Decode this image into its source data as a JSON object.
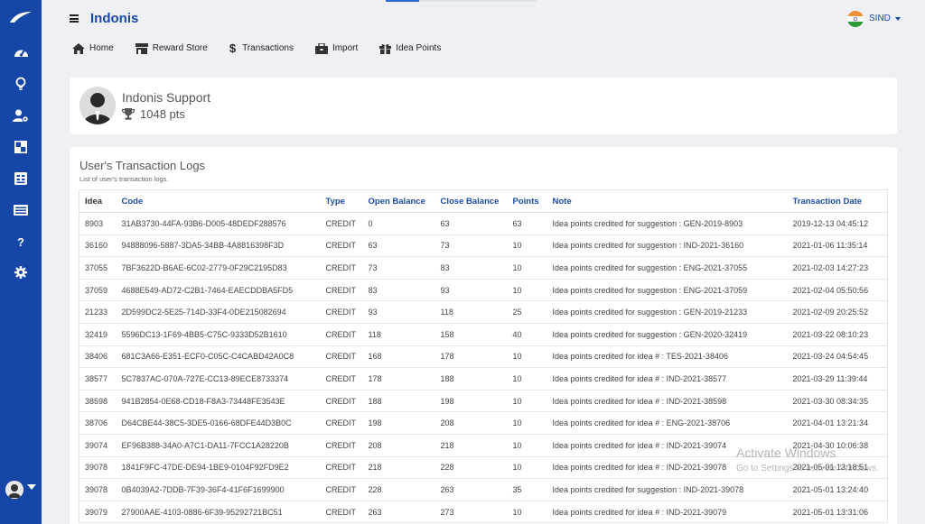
{
  "app": {
    "title": "Indonis"
  },
  "header": {
    "language": "SIND"
  },
  "nav": [
    {
      "label": "Home",
      "icon": "home-icon"
    },
    {
      "label": "Reward Store",
      "icon": "store-icon"
    },
    {
      "label": "Transactions",
      "icon": "dollar-icon"
    },
    {
      "label": "Import",
      "icon": "import-icon"
    },
    {
      "label": "Idea Points",
      "icon": "gift-icon"
    }
  ],
  "sidebar": {
    "icons": [
      "dashboard-icon",
      "lightbulb-icon",
      "user-settings-icon",
      "layout-icon",
      "calculator-icon",
      "list-icon",
      "help-icon",
      "settings-icon"
    ]
  },
  "profile": {
    "name": "Indonis Support",
    "points": "1048 pts"
  },
  "logs": {
    "title": "User's Transaction Logs",
    "subtitle": "List of user's transaction logs.",
    "columns": [
      "Idea",
      "Code",
      "Type",
      "Open Balance",
      "Close Balance",
      "Points",
      "Note",
      "Transaction Date"
    ],
    "rows": [
      [
        "8903",
        "31AB3730-44FA-93B6-D005-48DEDF288576",
        "CREDIT",
        "0",
        "63",
        "63",
        "Idea points credited for suggestion : GEN-2019-8903",
        "2019-12-13 04:45:12"
      ],
      [
        "36160",
        "94888096-5887-3DA5-34BB-4A8816398F3D",
        "CREDIT",
        "63",
        "73",
        "10",
        "Idea points credited for suggestion : IND-2021-36160",
        "2021-01-06 11:35:14"
      ],
      [
        "37055",
        "7BF3622D-B6AE-6C02-2779-0F29C2195D83",
        "CREDIT",
        "73",
        "83",
        "10",
        "Idea points credited for suggestion : ENG-2021-37055",
        "2021-02-03 14:27:23"
      ],
      [
        "37059",
        "4688E549-AD72-C2B1-7464-EAECDDBA5FD5",
        "CREDIT",
        "83",
        "93",
        "10",
        "Idea points credited for suggestion : ENG-2021-37059",
        "2021-02-04 05:50:56"
      ],
      [
        "21233",
        "2D599DC2-5E25-714D-33F4-0DE215082694",
        "CREDIT",
        "93",
        "118",
        "25",
        "Idea points credited for suggestion : GEN-2019-21233",
        "2021-02-09 20:25:52"
      ],
      [
        "32419",
        "5596DC13-1F69-4BB5-C75C-9333D52B1610",
        "CREDIT",
        "118",
        "158",
        "40",
        "Idea points credited for suggestion : GEN-2020-32419",
        "2021-03-22 08:10:23"
      ],
      [
        "38406",
        "681C3A66-E351-ECF0-C05C-C4CABD42A0C8",
        "CREDIT",
        "168",
        "178",
        "10",
        "Idea points credited for idea # : TES-2021-38406",
        "2021-03-24 04:54:45"
      ],
      [
        "38577",
        "5C7837AC-070A-727E-CC13-89ECE8733374",
        "CREDIT",
        "178",
        "188",
        "10",
        "Idea points credited for idea # : IND-2021-38577",
        "2021-03-29 11:39:44"
      ],
      [
        "38598",
        "941B2854-0E68-CD18-F8A3-73448FE3543E",
        "CREDIT",
        "188",
        "198",
        "10",
        "Idea points credited for idea # : IND-2021-38598",
        "2021-03-30 08:34:35"
      ],
      [
        "38706",
        "D64CBE44-38C5-3DE5-0166-68DFE44D3B0C",
        "CREDIT",
        "198",
        "208",
        "10",
        "Idea points credited for idea # : ENG-2021-38706",
        "2021-04-01 13:21:34"
      ],
      [
        "39074",
        "EF96B388-34A0-A7C1-DA11-7FCC1A28220B",
        "CREDIT",
        "208",
        "218",
        "10",
        "Idea points credited for idea # : IND-2021-39074",
        "2021-04-30 10:06:38"
      ],
      [
        "39078",
        "1841F9FC-47DE-DE94-1BE9-0104F92FD9E2",
        "CREDIT",
        "218",
        "228",
        "10",
        "Idea points credited for idea # : IND-2021-39078",
        "2021-05-01 13:18:51"
      ],
      [
        "39078",
        "0B4039A2-7DDB-7F39-36F4-41F6F1699900",
        "CREDIT",
        "228",
        "263",
        "35",
        "Idea points credited for suggestion : IND-2021-39078",
        "2021-05-01 13:24:40"
      ],
      [
        "39079",
        "27900AAE-4103-0886-6F39-95292721BC51",
        "CREDIT",
        "263",
        "273",
        "10",
        "Idea points credited for idea # : IND-2021-39079",
        "2021-05-01 13:31:06"
      ]
    ]
  },
  "watermark": {
    "line1": "Activate Windows",
    "line2": "Go to Settings to activate Windows."
  }
}
